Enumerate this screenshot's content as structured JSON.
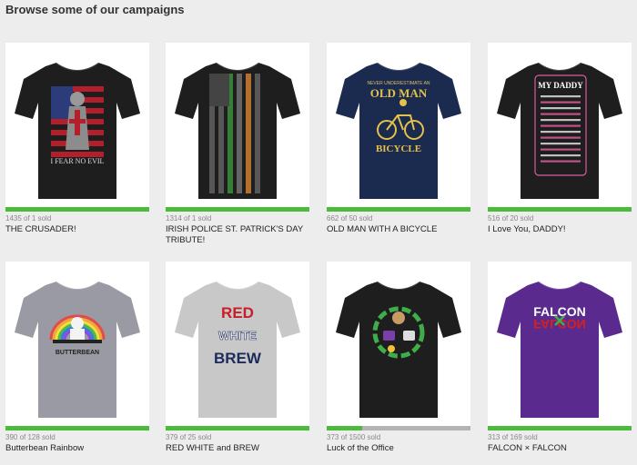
{
  "page": {
    "heading": "Browse some of our campaigns"
  },
  "accent_color": "#4cba3c",
  "campaigns": [
    {
      "sold": "1435 of 1 sold",
      "title": "THE CRUSADER!",
      "progress": 1.0,
      "shirt_color": "#1e1e1e",
      "design": "crusader",
      "art_text": "I FEAR NO EVIL"
    },
    {
      "sold": "1314 of 1 sold",
      "title": "IRISH POLICE ST. PATRICK'S DAY TRIBUTE!",
      "progress": 1.0,
      "shirt_color": "#1e1e1e",
      "design": "irish-flag",
      "art_text": ""
    },
    {
      "sold": "662 of 50 sold",
      "title": "OLD MAN WITH A BICYCLE",
      "progress": 1.0,
      "shirt_color": "#1b2a4f",
      "design": "bicycle",
      "art_text": "NEVER UNDERESTIMATE AN OLD MAN WITH A BICYCLE"
    },
    {
      "sold": "516 of 20 sold",
      "title": "I Love You, DADDY!",
      "progress": 1.0,
      "shirt_color": "#1e1e1e",
      "design": "daddy",
      "art_text": "MY DADDY"
    },
    {
      "sold": "390 of 128 sold",
      "title": "Butterbean Rainbow",
      "progress": 1.0,
      "shirt_color": "#9a9aa4",
      "design": "rainbow",
      "art_text": "BUTTERBEAN"
    },
    {
      "sold": "379 of 25 sold",
      "title": "RED WHITE and BREW",
      "progress": 1.0,
      "shirt_color": "#c8c8c8",
      "design": "brew",
      "art_text": "RED WHITE BREW"
    },
    {
      "sold": "373 of 1500 sold",
      "title": "Luck of the Office",
      "progress": 0.249,
      "shirt_color": "#1e1e1e",
      "design": "office",
      "art_text": ""
    },
    {
      "sold": "313 of 169 sold",
      "title": "FALCON × FALCON",
      "progress": 1.0,
      "shirt_color": "#5b2a8f",
      "design": "falcon",
      "art_text": "FALCON FALCON"
    }
  ]
}
